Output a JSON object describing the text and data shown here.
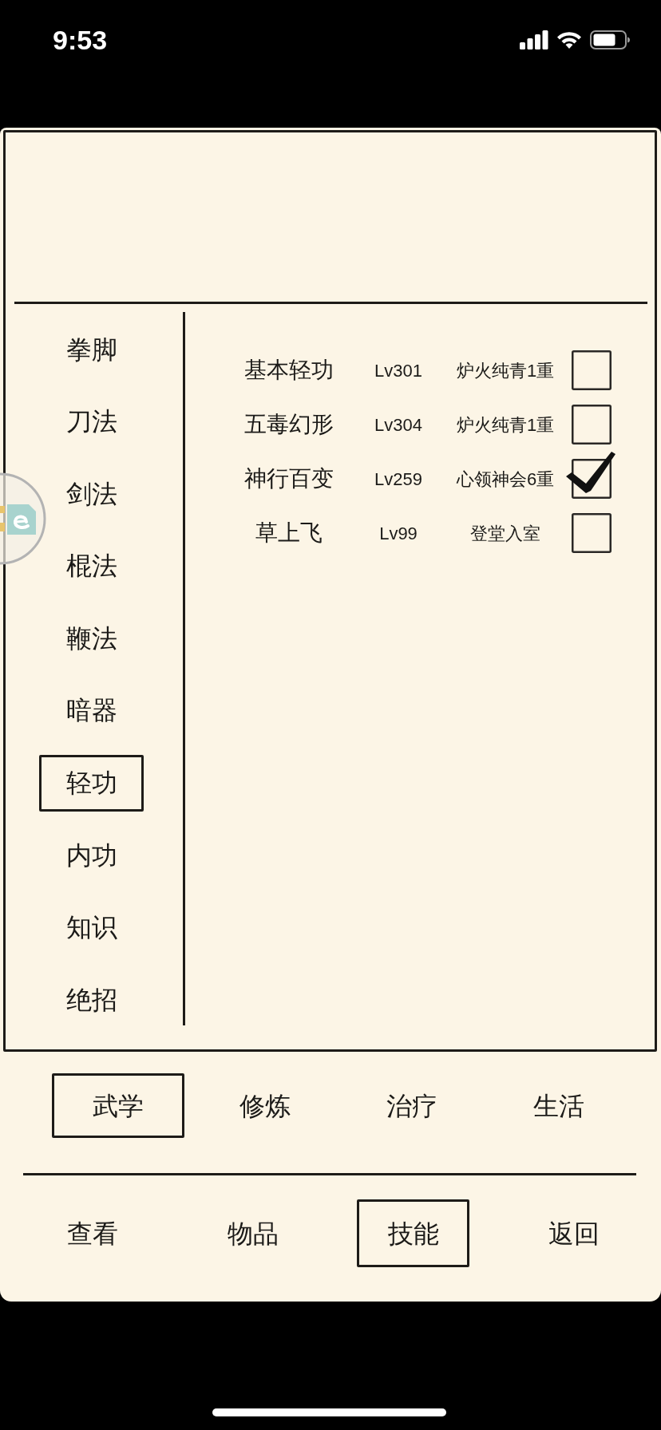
{
  "status_bar": {
    "time": "9:53"
  },
  "categories": [
    {
      "label": "拳脚",
      "selected": false
    },
    {
      "label": "刀法",
      "selected": false
    },
    {
      "label": "剑法",
      "selected": false
    },
    {
      "label": "棍法",
      "selected": false
    },
    {
      "label": "鞭法",
      "selected": false
    },
    {
      "label": "暗器",
      "selected": false
    },
    {
      "label": "轻功",
      "selected": true
    },
    {
      "label": "内功",
      "selected": false
    },
    {
      "label": "知识",
      "selected": false
    },
    {
      "label": "绝招",
      "selected": false
    }
  ],
  "skills": [
    {
      "name": "基本轻功",
      "lv": "Lv301",
      "realm": "炉火纯青1重",
      "checked": false
    },
    {
      "name": "五毒幻形",
      "lv": "Lv304",
      "realm": "炉火纯青1重",
      "checked": false
    },
    {
      "name": "神行百变",
      "lv": "Lv259",
      "realm": "心领神会6重",
      "checked": true
    },
    {
      "name": "草上飞",
      "lv": "Lv99",
      "realm": "登堂入室",
      "checked": false
    }
  ],
  "skill_types": [
    {
      "label": "武学",
      "selected": true
    },
    {
      "label": "修炼",
      "selected": false
    },
    {
      "label": "治疗",
      "selected": false
    },
    {
      "label": "生活",
      "selected": false
    }
  ],
  "bottom_nav": [
    {
      "label": "查看",
      "selected": false
    },
    {
      "label": "物品",
      "selected": false
    },
    {
      "label": "技能",
      "selected": true
    },
    {
      "label": "返回",
      "selected": false
    }
  ]
}
